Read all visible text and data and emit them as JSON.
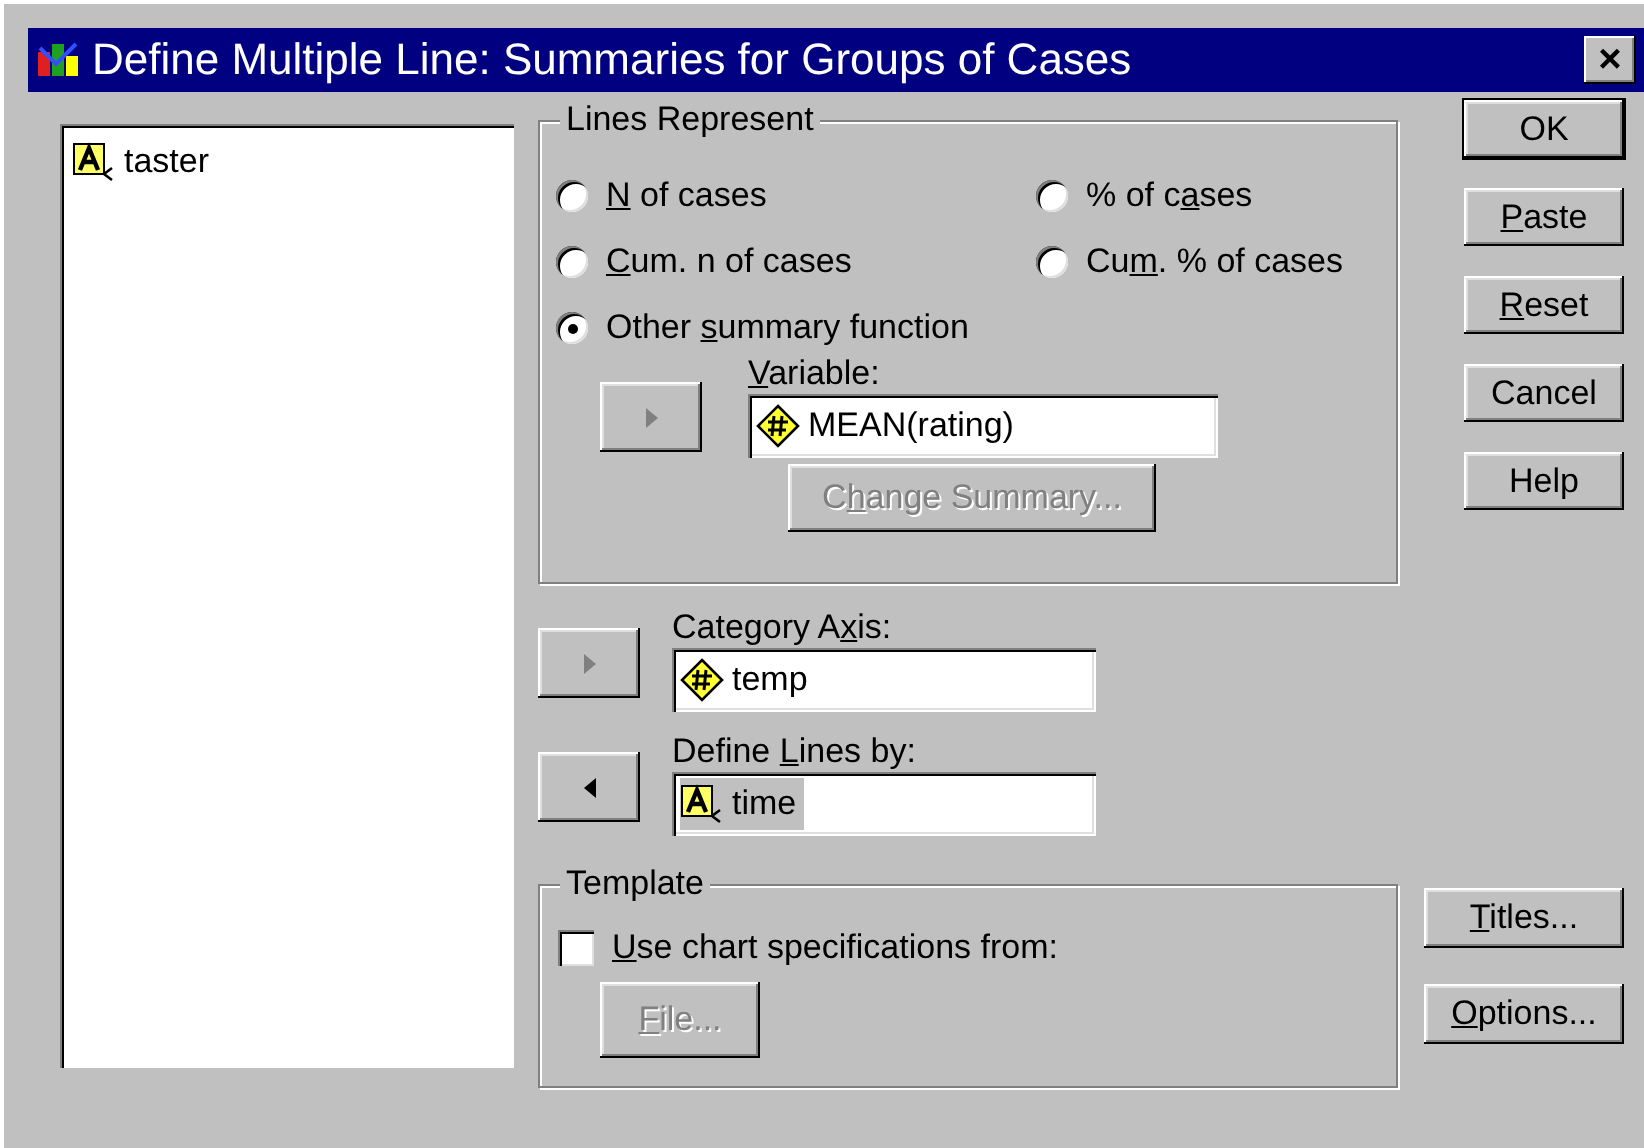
{
  "window": {
    "title": "Define Multiple Line: Summaries for Groups of Cases",
    "close": "×"
  },
  "source_variables": [
    {
      "name": "taster",
      "kind": "nominal"
    }
  ],
  "lines_represent": {
    "title": "Lines Represent",
    "options": [
      {
        "label": [
          {
            "text": "N",
            "underline": true
          },
          {
            "text": " of cases"
          }
        ],
        "selected": false
      },
      {
        "label": [
          {
            "text": "% of c"
          },
          {
            "text": "a",
            "underline": true
          },
          {
            "text": "ses"
          }
        ],
        "selected": false
      },
      {
        "label": [
          {
            "text": "C",
            "underline": true
          },
          {
            "text": "um. n of cases"
          }
        ],
        "selected": false
      },
      {
        "label": [
          {
            "text": "Cu"
          },
          {
            "text": "m",
            "underline": true
          },
          {
            "text": ". % of cases"
          }
        ],
        "selected": false
      },
      {
        "label": [
          {
            "text": "Other "
          },
          {
            "text": "s",
            "underline": true
          },
          {
            "text": "ummary function"
          }
        ],
        "selected": true
      }
    ],
    "variable": {
      "label": [
        {
          "text": "V",
          "underline": true
        },
        {
          "text": "ariable:"
        }
      ],
      "arrow_button": {
        "kind": "right",
        "disabled": true
      },
      "value": {
        "name": "MEAN(rating)",
        "kind": "scale",
        "highlighted": false
      }
    },
    "change_summary": {
      "label": [
        {
          "text": "C"
        },
        {
          "text": "h",
          "underline": true
        },
        {
          "text": "ange Summary..."
        }
      ],
      "disabled": true
    }
  },
  "category_axis": {
    "label": [
      {
        "text": "Category A"
      },
      {
        "text": "x",
        "underline": true
      },
      {
        "text": "is:"
      }
    ],
    "arrow_button": {
      "kind": "right",
      "disabled": true
    },
    "value": {
      "name": "temp",
      "kind": "scale",
      "highlighted": false
    }
  },
  "define_lines_by": {
    "label": [
      {
        "text": "Define "
      },
      {
        "text": "L",
        "underline": true
      },
      {
        "text": "ines by:"
      }
    ],
    "arrow_button": {
      "kind": "left",
      "disabled": false
    },
    "value": {
      "name": "time",
      "kind": "nominal",
      "highlighted": true
    }
  },
  "template": {
    "title": "Template",
    "checkbox": {
      "label": [
        {
          "text": "U",
          "underline": true
        },
        {
          "text": "se chart specifications from:"
        }
      ],
      "checked": false
    },
    "file_button": {
      "label": [
        {
          "text": "F",
          "underline": true
        },
        {
          "text": "ile..."
        }
      ],
      "disabled": true
    }
  },
  "buttons": [
    {
      "label": [
        {
          "text": "OK"
        }
      ],
      "default": true
    },
    {
      "label": [
        {
          "text": "P",
          "underline": true
        },
        {
          "text": "aste"
        }
      ],
      "default": false
    },
    {
      "label": [
        {
          "text": "R",
          "underline": true
        },
        {
          "text": "eset"
        }
      ],
      "default": false
    },
    {
      "label": [
        {
          "text": "Cancel"
        }
      ],
      "default": false
    },
    {
      "label": [
        {
          "text": "Help"
        }
      ],
      "default": false
    }
  ],
  "side_buttons": [
    {
      "label": [
        {
          "text": "T",
          "underline": true
        },
        {
          "text": "itles..."
        }
      ]
    },
    {
      "label": [
        {
          "text": "O",
          "underline": true
        },
        {
          "text": "ptions..."
        }
      ]
    }
  ]
}
